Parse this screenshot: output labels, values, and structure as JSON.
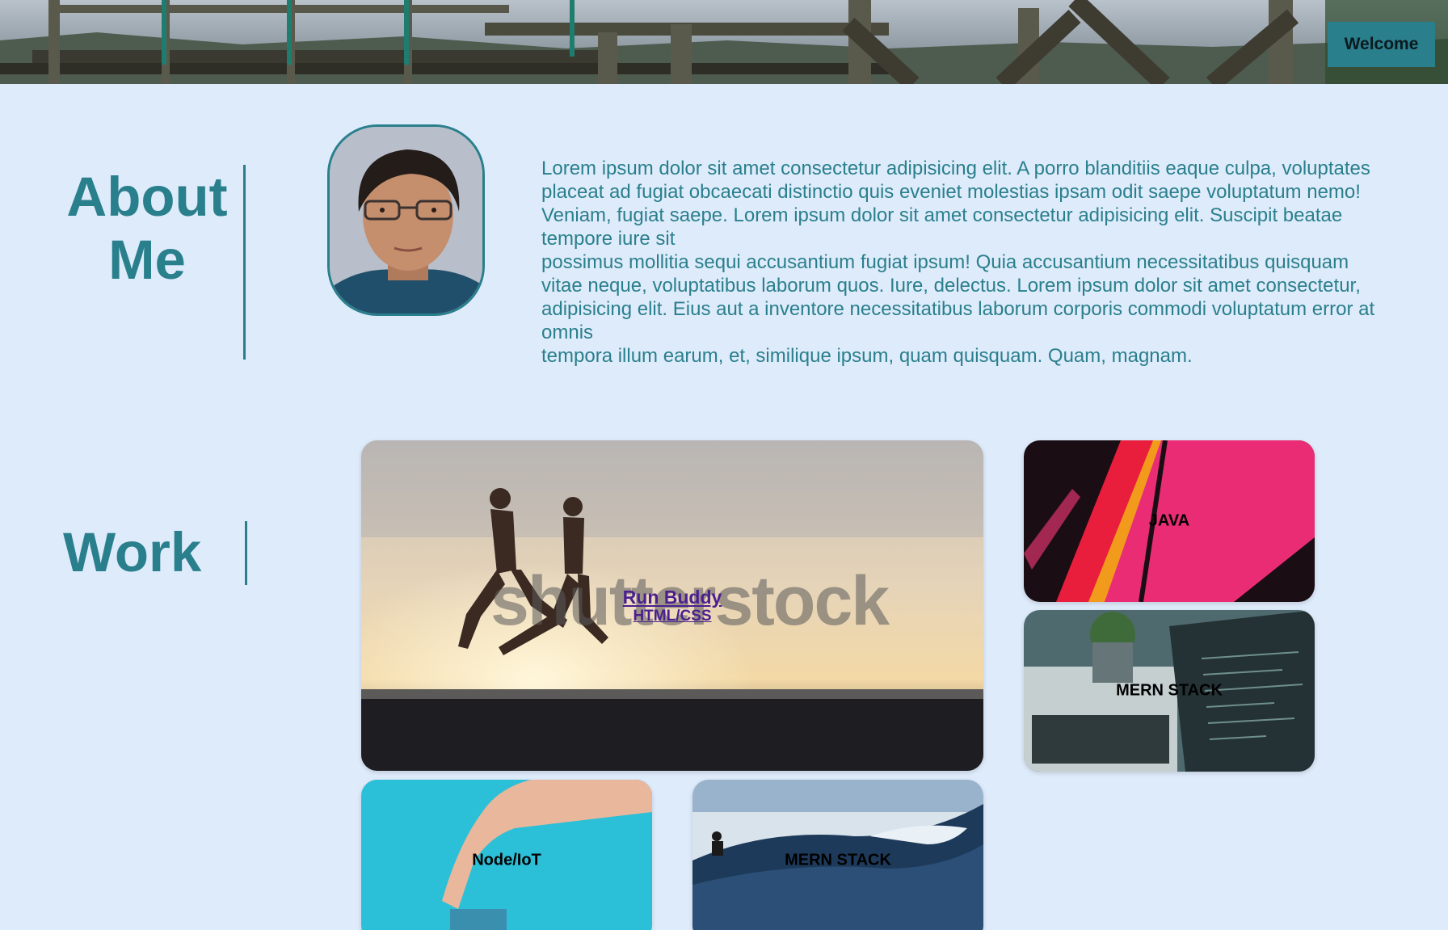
{
  "header": {
    "welcome_label": "Welcome"
  },
  "about": {
    "title": "About Me",
    "paragraphs": [
      "Lorem ipsum dolor sit amet consectetur adipisicing elit. A porro blanditiis eaque culpa, voluptates placeat ad fugiat obcaecati distinctio quis eveniet molestias ipsam odit saepe voluptatum nemo! Veniam, fugiat saepe. Lorem ipsum dolor sit amet consectetur adipisicing elit. Suscipit beatae tempore iure sit",
      "possimus mollitia sequi accusantium fugiat ipsum! Quia accusantium necessitatibus quisquam vitae neque, voluptatibus laborum quos. Iure, delectus. Lorem ipsum dolor sit amet consectetur, adipisicing elit. Eius aut a inventore necessitatibus laborum corporis commodi voluptatum error at omnis",
      "tempora illum earum, et, similique ipsum, quam quisquam. Quam, magnam."
    ]
  },
  "work": {
    "title": "Work",
    "projects": [
      {
        "name": "Run Buddy",
        "tech": "HTML/CSS"
      },
      {
        "name": "JAVA"
      },
      {
        "name": "MERN STACK"
      },
      {
        "name": "Node/IoT"
      },
      {
        "name": "MERN STACK"
      }
    ],
    "watermark": "shutterstock"
  },
  "colors": {
    "accent": "#2a7f8c",
    "background": "#deebfb",
    "link": "#4b1f91"
  }
}
